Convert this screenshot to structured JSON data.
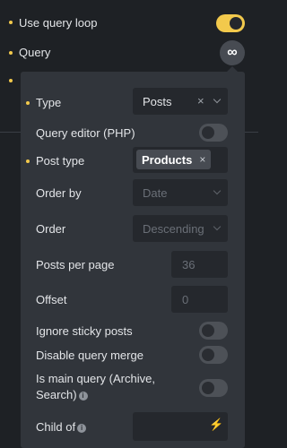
{
  "top": {
    "use_query_loop_label": "Use query loop",
    "use_query_loop_on": true,
    "query_label": "Query",
    "query_icon": "∞"
  },
  "panel": {
    "type_label": "Type",
    "type_value": "Posts",
    "query_editor_label": "Query editor (PHP)",
    "post_type_label": "Post type",
    "post_type_tag": "Products",
    "order_by_label": "Order by",
    "order_by_value": "Date",
    "order_label": "Order",
    "order_value": "Descending",
    "posts_per_page_label": "Posts per page",
    "posts_per_page_placeholder": "36",
    "offset_label": "Offset",
    "offset_placeholder": "0",
    "ignore_sticky_label": "Ignore sticky posts",
    "disable_merge_label": "Disable query merge",
    "is_main_query_label_1": "Is main query (Archive,",
    "is_main_query_label_2": "Search)",
    "child_of_label": "Child of"
  },
  "icons": {
    "clear": "×",
    "info": "i",
    "bolt": "⚡",
    "tag_remove": "×"
  },
  "colors": {
    "accent": "#f2c94c",
    "background": "#1e2125",
    "panel": "#31353b",
    "field": "#25282d"
  }
}
